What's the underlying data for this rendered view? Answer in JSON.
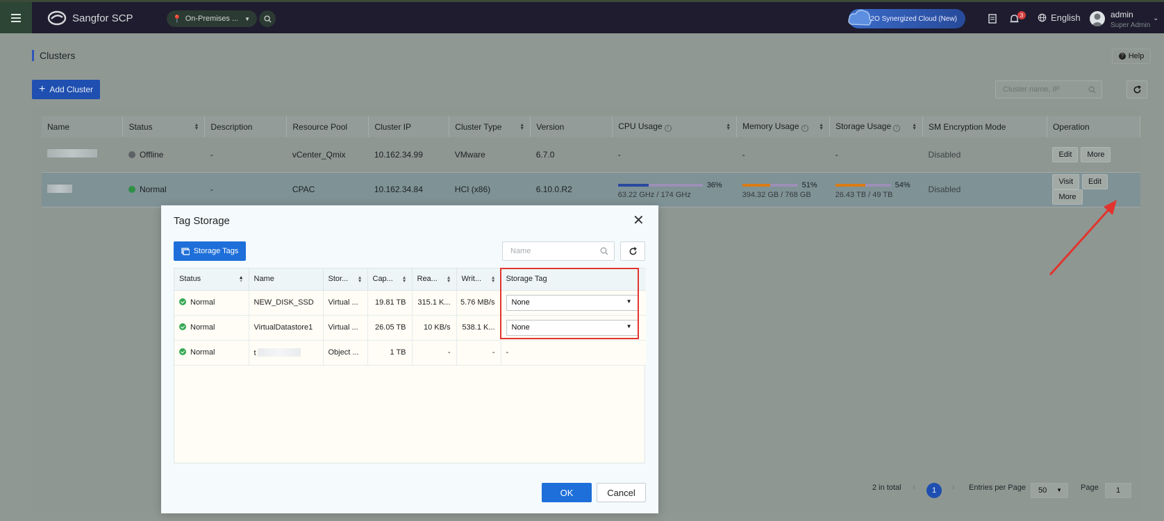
{
  "topbar": {
    "brand": "Sangfor SCP",
    "env_label": "On-Premises ...",
    "o2o_label": "O2O Synergized Cloud (New)",
    "notification_count": "3",
    "language": "English",
    "user_name": "admin",
    "user_role": "Super Admin"
  },
  "page": {
    "title": "Clusters",
    "help_label": "Help",
    "add_cluster_label": "Add Cluster",
    "search_placeholder": "Cluster name, IP"
  },
  "clusters_table": {
    "headers": [
      "Name",
      "Status",
      "Description",
      "Resource Pool",
      "Cluster IP",
      "Cluster Type",
      "Version",
      "CPU Usage",
      "Memory Usage",
      "Storage Usage",
      "SM Encryption Mode",
      "Operation"
    ],
    "rows": [
      {
        "status": "Offline",
        "description": "-",
        "resource_pool": "vCenter_Qmix",
        "cluster_ip": "10.162.34.99",
        "cluster_type": "VMware",
        "version": "6.7.0",
        "cpu": "-",
        "memory": "-",
        "storage": "-",
        "sm_encryption": "Disabled",
        "ops": [
          "Edit",
          "More"
        ]
      },
      {
        "status": "Normal",
        "description": "-",
        "resource_pool": "CPAC",
        "cluster_ip": "10.162.34.84",
        "cluster_type": "HCI (x86)",
        "version": "6.10.0.R2",
        "cpu_pct": "36%",
        "cpu_fraction": 0.36,
        "cpu_detail": "63.22 GHz / 174 GHz",
        "mem_pct": "51%",
        "mem_fraction": 0.51,
        "mem_detail": "394.32 GB / 768 GB",
        "stor_pct": "54%",
        "stor_fraction": 0.54,
        "stor_detail": "26.43 TB / 49 TB",
        "sm_encryption": "Disabled",
        "ops": [
          "Visit",
          "Edit",
          "More"
        ]
      }
    ]
  },
  "pagination": {
    "total": "2 in total",
    "current_page": "1",
    "entries_label": "Entries per Page",
    "entries_value": "50",
    "page_label": "Page",
    "page_value": "1"
  },
  "modal": {
    "title": "Tag Storage",
    "storage_tags_label": "Storage Tags",
    "name_placeholder": "Name",
    "headers": [
      "Status",
      "Name",
      "Stor...",
      "Cap...",
      "Rea...",
      "Writ...",
      "Storage Tag"
    ],
    "rows": [
      {
        "status": "Normal",
        "name": "NEW_DISK_SSD",
        "type": "Virtual ...",
        "capacity": "19.81 TB",
        "read": "315.1 K...",
        "write": "5.76 MB/s",
        "tag": "None"
      },
      {
        "status": "Normal",
        "name": "VirtualDatastore1",
        "type": "Virtual ...",
        "capacity": "26.05 TB",
        "read": "10 KB/s",
        "write": "538.1 K...",
        "tag": "None"
      },
      {
        "status": "Normal",
        "name": "t",
        "type": "Object ...",
        "capacity": "1 TB",
        "read": "-",
        "write": "-",
        "tag": "-"
      }
    ],
    "ok_label": "OK",
    "cancel_label": "Cancel"
  },
  "colors": {
    "accent": "#1e6fd9",
    "highlight_box": "#e2342e",
    "cpu_bar": "#2a4a9e",
    "mem_bar": "#d97c14",
    "status_normal": "#35a853"
  }
}
